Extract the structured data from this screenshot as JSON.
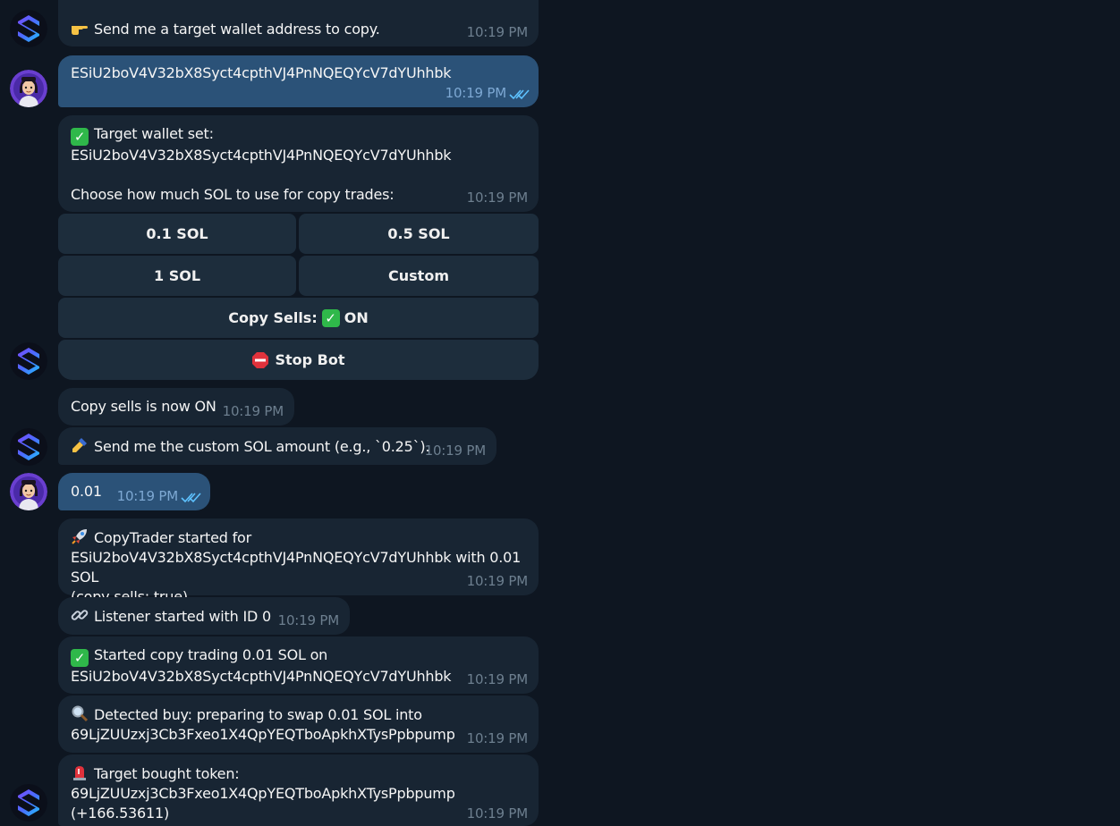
{
  "colors": {
    "bg": "#0e1621",
    "incoming": "#182533",
    "outgoing": "#2b5278",
    "button": "#1d2d3c",
    "time": "#6d7f8f"
  },
  "messages": [
    {
      "icon": "pointing-hand-icon",
      "text": "Send me a target wallet address to copy.",
      "time": "10:19 PM"
    },
    {
      "text": "ESiU2boV4V32bX8Syct4cpthVJ4PnNQEQYcV7dYUhhbk",
      "time": "10:19 PM"
    },
    {
      "icon": "check-mark-icon",
      "line1": "Target wallet set:",
      "line2": "ESiU2boV4V32bX8Syct4cpthVJ4PnNQEQYcV7dYUhhbk",
      "line3": "Choose how much SOL to use for copy trades:",
      "time": "10:19 PM"
    },
    {
      "text": "Copy sells is now ON",
      "time": "10:19 PM"
    },
    {
      "icon": "writing-hand-icon",
      "text": "Send me the custom SOL amount (e.g., `0.25`).",
      "time": "10:19 PM"
    },
    {
      "text": "0.01",
      "time": "10:19 PM"
    },
    {
      "icon": "rocket-icon",
      "line1": "CopyTrader started for",
      "line2": "ESiU2boV4V32bX8Syct4cpthVJ4PnNQEQYcV7dYUhhbk with 0.01 SOL",
      "line3": "(copy sells: true)",
      "time": "10:19 PM"
    },
    {
      "icon": "link-icon",
      "text": "Listener started with ID 0",
      "time": "10:19 PM"
    },
    {
      "icon": "check-mark-icon",
      "line1": "Started copy trading 0.01 SOL on",
      "line2": "ESiU2boV4V32bX8Syct4cpthVJ4PnNQEQYcV7dYUhhbk",
      "time": "10:19 PM"
    },
    {
      "icon": "magnifier-icon",
      "line1": "Detected buy: preparing to swap 0.01 SOL into",
      "line2": "69LjZUUzxj3Cb3Fxeo1X4QpYEQTboApkhXTysPpbpump",
      "time": "10:19 PM"
    },
    {
      "icon": "siren-icon",
      "line1": "Target bought token:",
      "line2": "69LjZUUzxj3Cb3Fxeo1X4QpYEQTboApkhXTysPpbpump (+166.53611)",
      "time": "10:19 PM"
    }
  ],
  "keyboard": {
    "sol_01": "0.1 SOL",
    "sol_05": "0.5 SOL",
    "sol_1": "1 SOL",
    "custom": "Custom",
    "copy_sells_label": "Copy Sells:",
    "copy_sells_state": "ON",
    "stop_bot": "Stop Bot"
  }
}
